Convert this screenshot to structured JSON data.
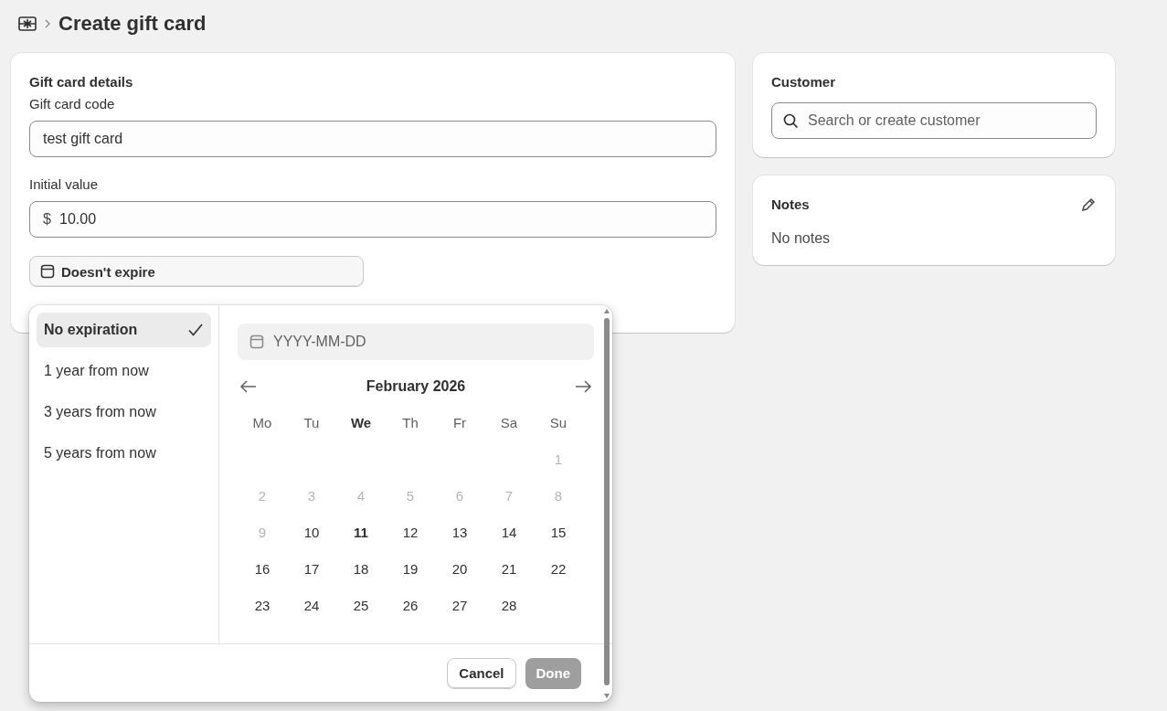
{
  "breadcrumb": {
    "title": "Create gift card"
  },
  "details": {
    "heading": "Gift card details",
    "code": {
      "label": "Gift card code",
      "value": "test gift card"
    },
    "value": {
      "label": "Initial value",
      "prefix": "$",
      "value": "10.00"
    },
    "expiry": {
      "label": "Doesn't expire"
    }
  },
  "customer": {
    "heading": "Customer",
    "search": {
      "placeholder": "Search or create customer"
    }
  },
  "notes": {
    "heading": "Notes",
    "text": "No notes"
  },
  "popover": {
    "presets": [
      {
        "label": "No expiration",
        "selected": true
      },
      {
        "label": "1 year from now",
        "selected": false
      },
      {
        "label": "3 years from now",
        "selected": false
      },
      {
        "label": "5 years from now",
        "selected": false
      }
    ],
    "date_field": {
      "placeholder": "YYYY-MM-DD"
    },
    "month": "February 2026",
    "weekdays": [
      {
        "label": "Mo",
        "current": false
      },
      {
        "label": "Tu",
        "current": false
      },
      {
        "label": "We",
        "current": true
      },
      {
        "label": "Th",
        "current": false
      },
      {
        "label": "Fr",
        "current": false
      },
      {
        "label": "Sa",
        "current": false
      },
      {
        "label": "Su",
        "current": false
      }
    ],
    "weeks": [
      [
        {
          "kind": "blank"
        },
        {
          "kind": "blank"
        },
        {
          "kind": "blank"
        },
        {
          "kind": "blank"
        },
        {
          "kind": "blank"
        },
        {
          "kind": "blank"
        },
        {
          "kind": "day",
          "label": "1",
          "disabled": true,
          "today": false
        }
      ],
      [
        {
          "label": "2",
          "disabled": true,
          "today": false
        },
        {
          "label": "3",
          "disabled": true,
          "today": false
        },
        {
          "label": "4",
          "disabled": true,
          "today": false
        },
        {
          "label": "5",
          "disabled": true,
          "today": false
        },
        {
          "label": "6",
          "disabled": true,
          "today": false
        },
        {
          "label": "7",
          "disabled": true,
          "today": false
        },
        {
          "label": "8",
          "disabled": true,
          "today": false
        }
      ],
      [
        {
          "label": "9",
          "disabled": true,
          "today": false
        },
        {
          "label": "10",
          "disabled": false,
          "today": false
        },
        {
          "label": "11",
          "disabled": false,
          "today": true
        },
        {
          "label": "12",
          "disabled": false,
          "today": false
        },
        {
          "label": "13",
          "disabled": false,
          "today": false
        },
        {
          "label": "14",
          "disabled": false,
          "today": false
        },
        {
          "label": "15",
          "disabled": false,
          "today": false
        }
      ],
      [
        {
          "label": "16",
          "disabled": false,
          "today": false
        },
        {
          "label": "17",
          "disabled": false,
          "today": false
        },
        {
          "label": "18",
          "disabled": false,
          "today": false
        },
        {
          "label": "19",
          "disabled": false,
          "today": false
        },
        {
          "label": "20",
          "disabled": false,
          "today": false
        },
        {
          "label": "21",
          "disabled": false,
          "today": false
        },
        {
          "label": "22",
          "disabled": false,
          "today": false
        }
      ],
      [
        {
          "label": "23",
          "disabled": false,
          "today": false
        },
        {
          "label": "24",
          "disabled": false,
          "today": false
        },
        {
          "label": "25",
          "disabled": false,
          "today": false
        },
        {
          "label": "26",
          "disabled": false,
          "today": false
        },
        {
          "label": "27",
          "disabled": false,
          "today": false
        },
        {
          "label": "28",
          "disabled": false,
          "today": false
        },
        {
          "kind": "blank"
        }
      ]
    ],
    "buttons": [
      {
        "label": "Cancel",
        "disabled": false
      },
      {
        "label": "Done",
        "disabled": true
      }
    ]
  }
}
